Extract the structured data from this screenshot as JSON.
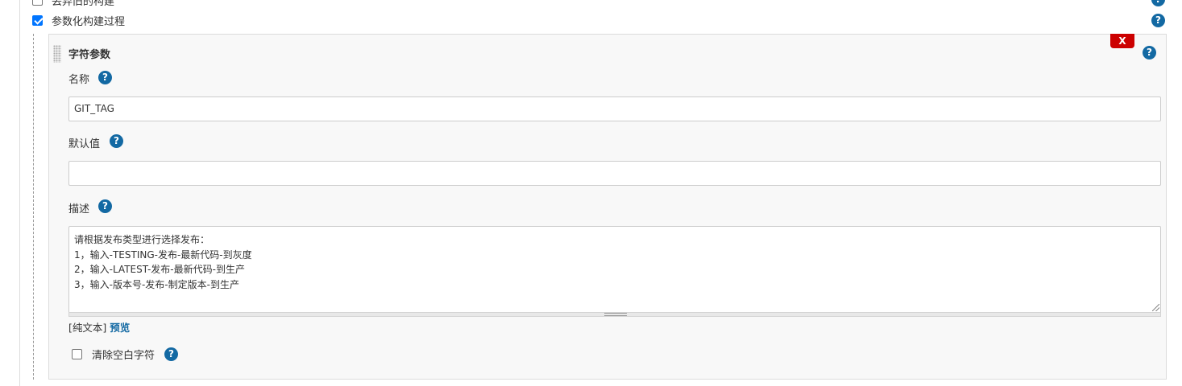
{
  "options": {
    "prev_option_label": "丢弃旧的构建",
    "parameterized_label": "参数化构建过程",
    "parameterized_checked": true,
    "prev_option_checked": false
  },
  "parameter": {
    "type_title": "字符参数",
    "delete_label": "X",
    "name_label": "名称",
    "name_value": "GIT_TAG",
    "default_label": "默认值",
    "default_value": "",
    "description_label": "描述",
    "description_lines": [
      "请根据发布类型进行选择发布：",
      "1，输入-TESTING-发布-最新代码-到灰度",
      "2，输入-LATEST-发布-最新代码-到生产",
      "3，输入-版本号-发布-制定版本-到生产"
    ],
    "text_mode": "[纯文本]",
    "preview_label": "预览",
    "trim_label": "清除空白字符",
    "trim_checked": false
  },
  "help_icon_glyph": "?",
  "colors": {
    "help_icon": "#1369a3",
    "delete_button": "#cc0000",
    "checkbox_checked": "#0075ff"
  }
}
